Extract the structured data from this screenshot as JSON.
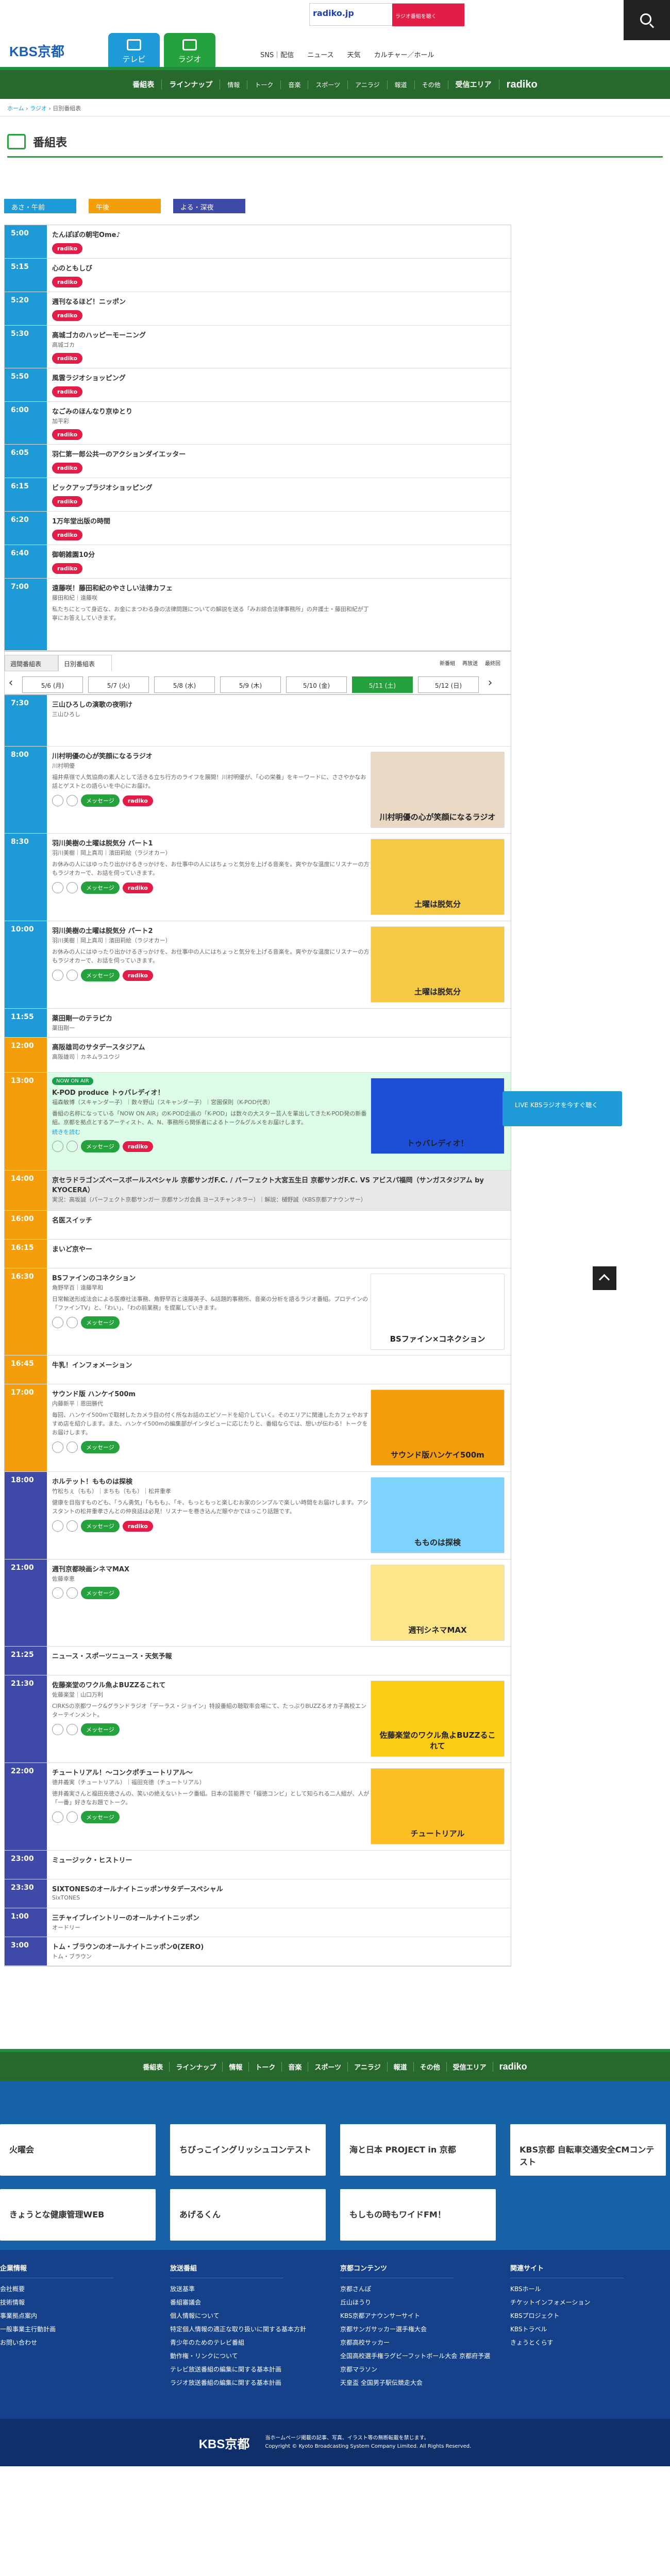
{
  "header": {
    "logo": "KBS京都",
    "tab_tv": "テレビ",
    "tab_radio": "ラジオ",
    "nav": [
      "SNS｜配信",
      "ニュース",
      "天気",
      "カルチャー／ホール"
    ],
    "radiko_label": "radiko.jp",
    "radiko_sub": "ラジオ番組を聴く"
  },
  "gnav": {
    "items": [
      "番組表",
      "ラインナップ",
      "情報",
      "トーク",
      "音楽",
      "スポーツ",
      "アニラジ",
      "報道",
      "その他",
      "受信エリア"
    ],
    "radiko": "radiko"
  },
  "breadcrumb": {
    "home": "ホーム",
    "radio": "ラジオ",
    "current": "日別番組表"
  },
  "page_title": "番組表",
  "periods": [
    "あさ・午前",
    "午後",
    "よる・深夜"
  ],
  "buttons": {
    "msg": "メッセージ",
    "radiko": "radiko"
  },
  "colors": {
    "morning": "#1e9bd7",
    "afternoon": "#f59e0b",
    "night": "#3f49a8",
    "gray": "#e8e8e8",
    "now": "#dcfce7"
  },
  "morning": [
    {
      "time": "5:00",
      "title": "たんぽぽの朝宅Ome♪",
      "radiko": true
    },
    {
      "time": "5:15",
      "title": "心のともしび",
      "radiko": true
    },
    {
      "time": "5:20",
      "title": "週刊なるほど！ニッポン",
      "radiko": true
    },
    {
      "time": "5:30",
      "title": "高城ゴカのハッピーモーニング",
      "cast": "高城ゴカ",
      "radiko": true
    },
    {
      "time": "5:50",
      "title": "風雲ラジオショッピング",
      "radiko": true
    },
    {
      "time": "6:00",
      "title": "なごみのほんなり京ゆとり",
      "cast": "加平彩",
      "radiko": true
    },
    {
      "time": "6:05",
      "title": "羽仁第一郎公共一のアクションダイエッター",
      "radiko": true
    },
    {
      "time": "6:15",
      "title": "ビックアップラジオショッピング",
      "radiko": true
    },
    {
      "time": "6:20",
      "title": "1万年堂出版の時間",
      "radiko": true
    },
    {
      "time": "6:40",
      "title": "御朝雑園10分",
      "radiko": true
    },
    {
      "time": "7:00",
      "title": "遠藤咲！藤田和紀のやさしい法律カフェ",
      "cast": "藤田和紀｜遠藤咲",
      "desc": "私たちにとって身近な、お金にまつわる身の法律問題についての解説を送る「みお綜合法律事務所」の弁護士・藤田和紀が丁寧にお答えしていきます。"
    }
  ],
  "tabs": [
    "週間番組表",
    "日別番組表"
  ],
  "days": [
    "5/6 (月)",
    "5/7 (火)",
    "5/8 (水)",
    "5/9 (木)",
    "5/10 (金)",
    "5/11 (土)",
    "5/12 (日)"
  ],
  "legend": [
    "新番組",
    "再放送",
    "最終回"
  ],
  "programs": [
    {
      "time": "7:30",
      "title": "三山ひろしの演歌の夜明け",
      "cast": "三山ひろし",
      "band": "morning"
    },
    {
      "time": "8:00",
      "title": "川村明優の心が笑顔になるラジオ",
      "cast": "川村明優",
      "desc": "福井県嶺で人気協商の素人として活きる立ち行方のライフを展開！川村明優が、「心の栄養」をキーワードに、ささやかなお話とゲストとの語らいを中心にお届け。",
      "band": "morning",
      "msg": true,
      "radiko": true,
      "thumb": "#e9d8c4",
      "thumb_text": "川村明優の心が笑顔になるラジオ"
    },
    {
      "time": "8:30",
      "title": "羽川美樹の土曜は脱気分 パート1",
      "cast": "羽川美樹｜岡上真司｜濱田莉絵（ラジオカー）",
      "desc": "お休みの人にはゆったり出かけるきっかけを、お仕事中の人にはちょっと気分を上げる音楽を。爽やかな温度にリスナーの方もラジオカーで、お話を伺っていきます。",
      "band": "morning",
      "msg": true,
      "radiko": true,
      "thumb": "#f6c945",
      "thumb_text": "土曜は脱気分"
    },
    {
      "time": "10:00",
      "title": "羽川美樹の土曜は脱気分 パート2",
      "cast": "羽川美樹｜岡上真司｜濱田莉絵（ラジオカー）",
      "desc": "お休みの人にはゆったり出かけるきっかけを、お仕事中の人にはちょっと気分を上げる音楽を。爽やかな温度にリスナーの方もラジオカーで、お話を伺っていきます。",
      "band": "morning",
      "msg": true,
      "radiko": true,
      "thumb": "#f6c945",
      "thumb_text": "土曜は脱気分"
    },
    {
      "time": "11:55",
      "title": "薬田剛一のテラピカ",
      "cast": "薬田剛一",
      "band": "morning"
    },
    {
      "time": "12:00",
      "title": "高阪雄司のサタデースタジアム",
      "cast": "高阪雄司｜カネムラユウジ",
      "band": "afternoon"
    },
    {
      "time": "13:00",
      "title": "K-POD produce トゥバレディオ！",
      "cast": "福森敏博（スキャンダー子）｜数々野山（スキャンダー子）｜宮園保則（K-POD代表）",
      "desc": "番組の名称になっている「NOW ON AIR」のK-POD企画の「K-POD」は数々の大スター芸人を輩出してきたK-POD発の新番組。京都を拠点とするアーティスト、A、N、事務所ら関係者によるトーク&グルメをお届けします。",
      "band": "afternoon",
      "now": true,
      "msg": true,
      "radiko": true,
      "thumb": "#1d4ed8",
      "thumb_text": "トゥバレディオ！",
      "badge": "NOW ON AIR",
      "more": "続きを読む"
    },
    {
      "time": "14:00",
      "title": "京セラドラゴンズベースボールスペシャル 京都サンガF.C. / パーフェクト大宮五生日 京都サンガF.C. VS アビスパ福岡（サンガスタジアム by KYOCERA）",
      "cast": "実況：高坂誠（パーフェクト京都サンガ一 京都サンガ会員 ヨースチャンネラー）｜解説：樋野誠（KBS京都アナウンサー）",
      "band": "afternoon",
      "gray": true
    },
    {
      "time": "16:00",
      "title": "名医スイッチ",
      "band": "afternoon"
    },
    {
      "time": "16:15",
      "title": "まいど京やー",
      "band": "afternoon"
    },
    {
      "time": "16:30",
      "title": "BSファインのコネクション",
      "cast": "角野早百｜遠藤早和",
      "desc": "日常輸送形成法会による医療社法事務、角野早百と遠藤英子、&話題的事務所、音楽の分析を語るラジオ番組。プロテインの「ファインTV」と、「わい」、「わの前業務」を提案していきます。",
      "band": "afternoon",
      "msg": true,
      "thumb": "#ffffff",
      "thumb_text": "BSファイン×コネクション"
    },
    {
      "time": "16:45",
      "title": "牛乳！インフォメーション",
      "band": "afternoon"
    },
    {
      "time": "17:00",
      "title": "サウンド版 ハンケイ500m",
      "cast": "内藤新平｜恩田勝代",
      "desc": "毎回、ハンケイ500mで取材したカメラ目の付く所なお話のエピソードを紹介していく。そのエリアに関連したカフェやおすすめ店を紹介します。また、ハンケイ500mの編集部がインタビューに応じたりと、番組ならでは、想いが伝わる！トークをお届けします。",
      "band": "afternoon",
      "msg": true,
      "thumb": "#f59e0b",
      "thumb_text": "サウンド版ハンケイ500m"
    },
    {
      "time": "18:00",
      "title": "ホルテット！もものは探検",
      "cast": "竹松ちぇ（もも）｜まちも（もも）｜松井重孝",
      "desc": "健康を目指すものども、「うん勇気」「ももも」、「キ、もっともっと楽しむお家のシンプルで楽しい時間をお届けします。アシスタントの松井重孝さんとの仲良話は必見！リスナーを巻き込んだ賑やかでほっこり話題です。",
      "band": "night",
      "msg": true,
      "radiko": true,
      "thumb": "#7dd3fc",
      "thumb_text": "もものは探検"
    },
    {
      "time": "21:00",
      "title": "週刊京都映画シネマMAX",
      "cast": "佐藤幸恵",
      "band": "night",
      "msg": true,
      "thumb": "#fde68a",
      "thumb_text": "週刊シネマMAX"
    },
    {
      "time": "21:25",
      "title": "ニュース・スポーツニュース・天気予報",
      "band": "night"
    },
    {
      "time": "21:30",
      "title": "佐藤楽堂のワクル魚よBUZZるこれて",
      "cast": "佐藤楽堂｜山口万利",
      "desc": "CIRKSの京都ワーク&グランドラジオ「デーラス・ジョイン」特設番組の聴取率会場にて、たっぷりBUZZるオカ子高校エンターテインメント。",
      "band": "night",
      "msg": true,
      "thumb": "#facc15",
      "thumb_text": "佐藤楽堂のワクル魚よBUZZるこれて"
    },
    {
      "time": "22:00",
      "title": "チュートリアル！～コンクポチュートリアル～",
      "cast": "徳井義実（チュートリアル）｜福田充徳（チュートリアル）",
      "desc": "徳井義実さんと福田充徳さんの、笑いの絶えないトーク番組。日本の芸能界で「福徳コンビ」として知られる二人組が、人が「一番」好きなお題でトーク。",
      "band": "night",
      "msg": true,
      "thumb": "#fbbf24",
      "thumb_text": "チュートリアル"
    },
    {
      "time": "23:00",
      "title": "ミュージック・ヒストリー",
      "band": "night"
    },
    {
      "time": "23:30",
      "title": "SIXTONESのオールナイトニッポンサタデースペシャル",
      "cast": "SixTONES",
      "band": "night"
    },
    {
      "time": "1:00",
      "title": "三チャイブレイントリーのオールナイトニッポン",
      "cast": "オードリー",
      "band": "night"
    },
    {
      "time": "3:00",
      "title": "トム・ブラウンのオールナイトニッポン0(ZERO)",
      "cast": "トム・ブラウン",
      "band": "night"
    }
  ],
  "live": {
    "label": "LIVE",
    "text": "KBSラジオを今すぐ聴く"
  },
  "banners": [
    "火曜会",
    "ちびっこイングリッシュコンテスト",
    "海と日本 PROJECT in 京都",
    "KBS京都 自転車交通安全CMコンテスト",
    "きょうとな健康管理WEB",
    "あげるくん",
    "もしもの時もワイドFM！"
  ],
  "footer": {
    "cols": [
      {
        "title": "企業情報",
        "items": [
          "会社概要",
          "技術情報",
          "事業拠点案内",
          "一般事業主行動計画",
          "お問い合わせ"
        ]
      },
      {
        "title": "放送番組",
        "items": [
          "放送基準",
          "番組審議会",
          "個人情報について",
          "特定個人情報の適正な取り扱いに関する基本方針",
          "青少年のためのテレビ番組",
          "動作権・リンクについて",
          "テレビ放送番組の編集に関する基本計画",
          "ラジオ放送番組の編集に関する基本計画"
        ]
      },
      {
        "title": "京都コンテンツ",
        "items": [
          "京都さんぽ",
          "丘山ほうり",
          "KBS京都アナウンサーサイト",
          "京都サンガサッカー選手権大会",
          "京都高校サッカー",
          "全国高校選手権ラグビーフットボール大会 京都府予選",
          "京都マラソン",
          "天皇盃 全国男子駅伝競走大会"
        ]
      },
      {
        "title": "関連サイト",
        "items": [
          "KBSホール",
          "チケットインフォメーション",
          "KBSプロジェクト",
          "KBSトラベル",
          "きょうとくらす"
        ]
      }
    ],
    "copy_logo": "KBS京都",
    "copy1": "当ホームページ掲載の記事、写真、イラスト等の無断転載を禁じます。",
    "copy2": "Copyright © Kyoto Broadcasting System Company Limited. All Rights Reserved."
  }
}
